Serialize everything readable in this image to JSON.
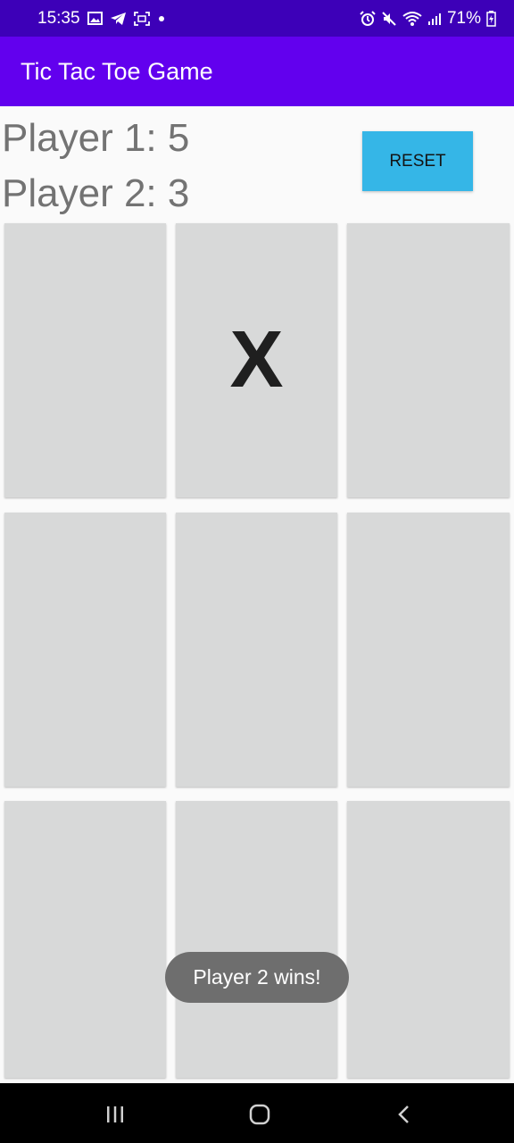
{
  "status_bar": {
    "time": "15:35",
    "battery": "71%",
    "icons": [
      "gallery-icon",
      "telegram-icon",
      "screenshot-icon",
      "dot-icon",
      "alarm-icon",
      "mute-icon",
      "wifi-icon",
      "signal-icon",
      "battery-icon"
    ]
  },
  "app_bar": {
    "title": "Tic Tac Toe Game",
    "color": "#6200ee"
  },
  "scores": {
    "player1": "Player 1: 5",
    "player2": "Player 2: 3"
  },
  "reset_button": {
    "label": "RESET",
    "color": "#35b6e7"
  },
  "board": {
    "cells": [
      "",
      "X",
      "",
      "",
      "",
      "",
      "",
      "",
      ""
    ]
  },
  "toast": {
    "message": "Player 2 wins!"
  },
  "nav_bar": {
    "icons": [
      "recents-icon",
      "home-icon",
      "back-icon"
    ]
  }
}
